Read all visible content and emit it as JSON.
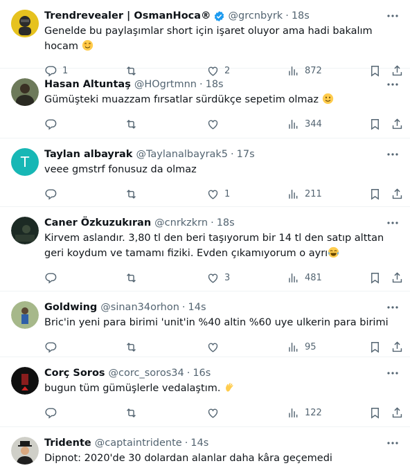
{
  "tweets": [
    {
      "name": "Trendrevealer | OsmanHoca®",
      "handle": "@grcnbyrk",
      "time": "18s",
      "verified": true,
      "text": "Genelde bu paylaşımlar short için işaret oluyor ama hadi bakalım hocam",
      "emoji": "smiling-face-emoji",
      "replies": "1",
      "retweets": "",
      "likes": "2",
      "views": "872",
      "avatar_color": "#e6c21f"
    },
    {
      "name": "Hasan Altuntaş",
      "handle": "@HOgrtmnn",
      "time": "18s",
      "verified": false,
      "text": "Gümüşteki muazzam fırsatlar sürdükçe sepetim olmaz",
      "emoji": "slightly-smiling-face-emoji",
      "replies": "",
      "retweets": "",
      "likes": "",
      "views": "344",
      "avatar_color": "#4a5a40"
    },
    {
      "name": "Taylan albayrak",
      "handle": "@Taylanalbayrak5",
      "time": "17s",
      "verified": false,
      "text": "veee gmstrf fonusuz da olmaz",
      "emoji": "",
      "replies": "",
      "retweets": "",
      "likes": "1",
      "views": "211",
      "avatar_letter": "T",
      "avatar_color": "#17b7b5"
    },
    {
      "name": "Caner Özkuzukıran",
      "handle": "@cnrkzkrn",
      "time": "18s",
      "verified": false,
      "text": "Kirvem aslandır. 3,80 tl den beri taşıyorum bir 14 tl den satıp alttan geri koydum ve tamamı fiziki. Evden çıkamıyorum o ayrı",
      "emoji": "face-with-tears-of-joy-emoji",
      "replies": "",
      "retweets": "",
      "likes": "3",
      "views": "481",
      "avatar_color": "#1c2a24"
    },
    {
      "name": "Goldwing",
      "handle": "@sinan34orhon",
      "time": "14s",
      "verified": false,
      "text": "Bric'in yeni para birimi 'unit'in %40 altin %60 uye ulkerin para birimi",
      "emoji": "",
      "replies": "",
      "retweets": "",
      "likes": "",
      "views": "95",
      "avatar_color": "#7f9a6a"
    },
    {
      "name": "Corç Soros",
      "handle": "@corc_soros34",
      "time": "16s",
      "verified": false,
      "text": "bugun tüm gümüşlerle vedalaştım.",
      "emoji": "waving-hand-emoji",
      "replies": "",
      "retweets": "",
      "likes": "",
      "views": "122",
      "avatar_color": "#101010"
    },
    {
      "name": "Tridente",
      "handle": "@captaintridente",
      "time": "14s",
      "verified": false,
      "text": "Dipnot: 2020'de 30 dolardan alanlar daha kâra geçemedi",
      "emoji": "",
      "replies": "",
      "retweets": "",
      "likes": "",
      "views": "",
      "avatar_color": "#cfcfc8"
    }
  ],
  "ui": {
    "dot": "·",
    "text_color": "#0f1419",
    "muted_color": "#536471",
    "verified_color": "#1d9bf0"
  }
}
